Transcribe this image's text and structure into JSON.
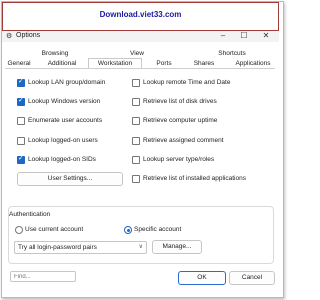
{
  "banner": {
    "text": "Download.viet33.com"
  },
  "window": {
    "title": "Options",
    "gear_icon": "gear-icon",
    "minimize": "–",
    "maximize": "☐",
    "close": "✕"
  },
  "tabs_top": [
    "Browsing",
    "View",
    "Shortcuts"
  ],
  "tabs_bottom": [
    "General",
    "Additional",
    "Workstation",
    "Ports",
    "Shares",
    "Applications"
  ],
  "active_tab": "Workstation",
  "left_options": [
    {
      "label": "Lookup LAN group/domain",
      "checked": true
    },
    {
      "label": "Lookup Windows version",
      "checked": true
    },
    {
      "label": "Enumerate user accounts",
      "checked": false
    },
    {
      "label": "Lookup logged-on users",
      "checked": false
    },
    {
      "label": "Lookup logged-on SIDs",
      "checked": true
    }
  ],
  "right_options": [
    {
      "label": "Lookup remote Time and Date",
      "checked": false
    },
    {
      "label": "Retrieve list of disk drives",
      "checked": false
    },
    {
      "label": "Retrieve computer uptime",
      "checked": false
    },
    {
      "label": "Retrieve assigned comment",
      "checked": false
    },
    {
      "label": "Lookup server type/roles",
      "checked": false
    },
    {
      "label": "Retrieve list of installed applications",
      "checked": false
    }
  ],
  "user_settings_button": "User Settings...",
  "authentication": {
    "title": "Authentication",
    "use_current": "Use current account",
    "specific": "Specific account",
    "selected": "specific",
    "select_value": "Try all login-password pairs",
    "manage_button": "Manage..."
  },
  "footer": {
    "find_placeholder": "Find...",
    "ok": "OK",
    "cancel": "Cancel"
  },
  "colors": {
    "accent": "#1e67c2",
    "banner_text": "#1a1aa0",
    "banner_border": "#a33a3a"
  }
}
